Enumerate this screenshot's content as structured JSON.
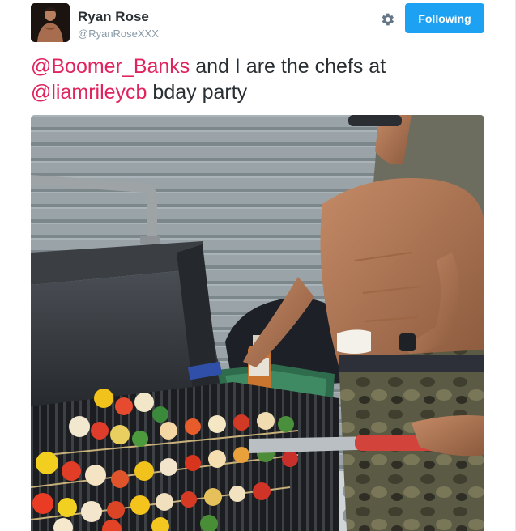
{
  "user": {
    "display_name": "Ryan Rose",
    "handle": "@RyanRoseXXX"
  },
  "actions": {
    "follow_label": "Following",
    "settings_icon": "gear-icon"
  },
  "tweet": {
    "mention_1": "@Boomer_Banks",
    "text_1": " and I are the chefs at",
    "mention_2": "@liamrileycb",
    "text_2": " bday party"
  },
  "colors": {
    "accent": "#1da1f2",
    "mention": "#e0245e",
    "text": "#292f33",
    "muted": "#8899a6"
  }
}
